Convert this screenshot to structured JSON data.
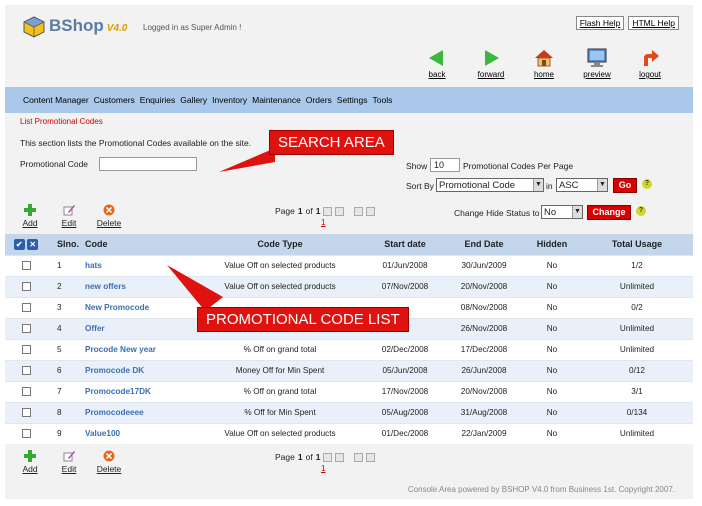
{
  "header": {
    "brand": "BShop",
    "version": "V4.0",
    "logged_in": "Logged in as Super Admin !",
    "flash_help": "Flash Help",
    "html_help": "HTML Help"
  },
  "nav": {
    "back": "back",
    "forward": "forward",
    "home": "home",
    "preview": "preview",
    "logout": "logout"
  },
  "menu": [
    "Content Manager",
    "Customers",
    "Enquiries",
    "Gallery",
    "Inventory",
    "Maintenance",
    "Orders",
    "Settings",
    "Tools"
  ],
  "breadcrumb": "List Promotional Codes",
  "intro": "This section lists the Promotional Codes available on the site.",
  "callouts": {
    "search": "SEARCH AREA",
    "list": "PROMOTIONAL CODE LIST"
  },
  "search": {
    "code_label": "Promotional Code",
    "code_value": "",
    "show_label": "Show",
    "show_value": "10",
    "per_page_label": "Promotional Codes Per Page",
    "sort_by_label": "Sort By",
    "sort_by_value": "Promotional Code",
    "in_label": "in",
    "order_value": "ASC",
    "go_label": "Go"
  },
  "actions": {
    "add": "Add",
    "edit": "Edit",
    "delete": "Delete"
  },
  "pager": {
    "page_text": "Page",
    "current": "1",
    "of_text": "of",
    "total": "1",
    "page_link": "1"
  },
  "hide_status": {
    "label": "Change Hide Status to",
    "value": "No",
    "button": "Change"
  },
  "table": {
    "columns": [
      "Slno.",
      "Code",
      "Code Type",
      "Start date",
      "End Date",
      "Hidden",
      "Total Usage"
    ],
    "rows": [
      {
        "sl": "1",
        "code": "hats",
        "type": "Value Off on selected products",
        "start": "01/Jun/2008",
        "end": "30/Jun/2009",
        "hidden": "No",
        "usage": "1/2"
      },
      {
        "sl": "2",
        "code": "new offers",
        "type": "Value Off on selected products",
        "start": "07/Nov/2008",
        "end": "20/Nov/2008",
        "hidden": "No",
        "usage": "Unlimited"
      },
      {
        "sl": "3",
        "code": "New Promocode",
        "type": "",
        "start": "",
        "end": "08/Nov/2008",
        "hidden": "No",
        "usage": "0/2"
      },
      {
        "sl": "4",
        "code": "Offer",
        "type": "",
        "start": "",
        "end": "26/Nov/2008",
        "hidden": "No",
        "usage": "Unlimited"
      },
      {
        "sl": "5",
        "code": "Procode New year",
        "type": "% Off on grand total",
        "start": "02/Dec/2008",
        "end": "17/Dec/2008",
        "hidden": "No",
        "usage": "Unlimited"
      },
      {
        "sl": "6",
        "code": "Promocode DK",
        "type": "Money Off for Min Spent",
        "start": "05/Jun/2008",
        "end": "26/Jun/2008",
        "hidden": "No",
        "usage": "0/12"
      },
      {
        "sl": "7",
        "code": "Promocode17DK",
        "type": "% Off on grand total",
        "start": "17/Nov/2008",
        "end": "20/Nov/2008",
        "hidden": "No",
        "usage": "3/1"
      },
      {
        "sl": "8",
        "code": "Promocodeeee",
        "type": "% Off for Min Spent",
        "start": "05/Aug/2008",
        "end": "31/Aug/2008",
        "hidden": "No",
        "usage": "0/134"
      },
      {
        "sl": "9",
        "code": "Value100",
        "type": "Value Off on selected products",
        "start": "01/Dec/2008",
        "end": "22/Jan/2009",
        "hidden": "No",
        "usage": "Unlimited"
      }
    ]
  },
  "footer": "Console Area powered by BSHOP V4.0 from Business 1st. Copyright 2007.",
  "colors": {
    "menu_bg": "#a9c8ea",
    "header_row": "#c4d6ec",
    "alt_row": "#e9f0f9",
    "callout": "#e0120f",
    "code_link": "#3c6fb1"
  }
}
